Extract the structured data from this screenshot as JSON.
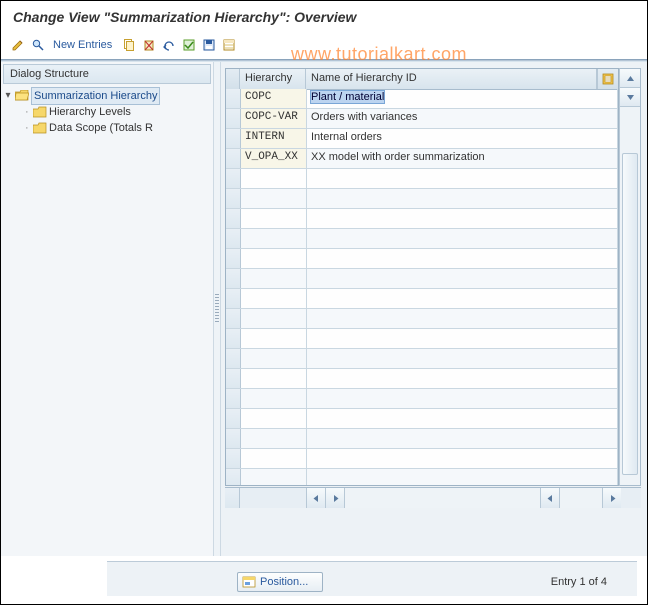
{
  "title": "Change View \"Summarization Hierarchy\": Overview",
  "watermark": "www.tutorialkart.com",
  "toolbar": {
    "new_entries_label": "New Entries"
  },
  "dialog_structure": {
    "header": "Dialog Structure",
    "root_label": "Summarization Hierarchy",
    "children": [
      {
        "label": "Hierarchy Levels"
      },
      {
        "label": "Data Scope (Totals R"
      }
    ]
  },
  "grid": {
    "columns": {
      "c1": "Hierarchy",
      "c2": "Name of Hierarchy ID"
    },
    "rows": [
      {
        "id": "COPC",
        "name": "Plant / material"
      },
      {
        "id": "COPC-VAR",
        "name": "Orders with variances"
      },
      {
        "id": "INTERN",
        "name": "Internal orders"
      },
      {
        "id": "V_OPA_XX",
        "name": "XX model with order summarization"
      }
    ],
    "empty_rows": 16
  },
  "status": {
    "position_label": "Position...",
    "entry_count": "Entry 1 of 4"
  },
  "colors": {
    "accent": "#2a5a9e",
    "watermark": "#ff7f27",
    "cell_code_bg": "#f8f6e8",
    "selection_bg": "#bcd4f0"
  }
}
